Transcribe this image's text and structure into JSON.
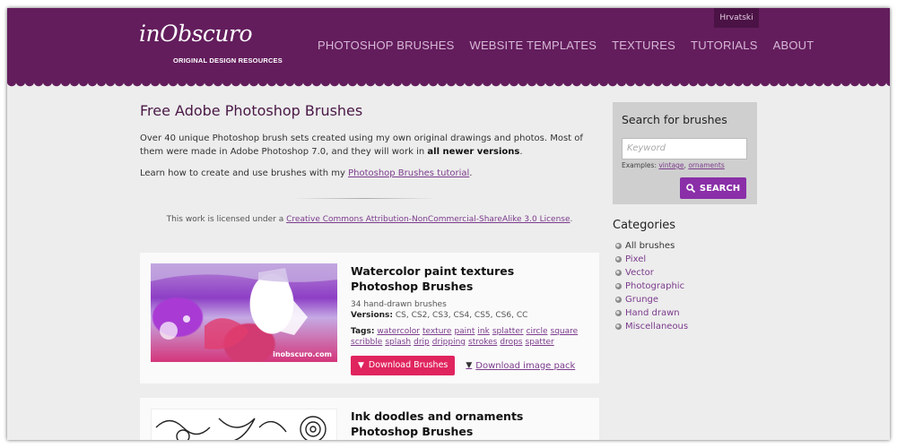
{
  "header": {
    "language_link": "Hrvatski",
    "logo_text": "inObscuro",
    "logo_subtitle": "ORIGINAL DESIGN RESOURCES",
    "nav": [
      "PHOTOSHOP BRUSHES",
      "WEBSITE TEMPLATES",
      "TEXTURES",
      "TUTORIALS",
      "ABOUT"
    ]
  },
  "main": {
    "title": "Free Adobe Photoshop Brushes",
    "intro_1": "Over 40 unique Photoshop brush sets created using my own original drawings and photos. Most of them were made in Adobe Photoshop 7.0, and they will work in ",
    "intro_1_bold": "all newer versions",
    "intro_1_end": ".",
    "intro_2": "Learn how to create and use brushes with my ",
    "intro_2_link": "Photoshop Brushes tutorial",
    "intro_2_end": ".",
    "license_text": "This work is licensed under a ",
    "license_link": "Creative Commons Attribution-NonCommercial-ShareAlike 3.0 License",
    "license_end": "."
  },
  "cards": [
    {
      "title": "Watercolor paint textures Photoshop Brushes",
      "count": "34 hand-drawn brushes",
      "versions_label": "Versions:",
      "versions": " CS, CS2, CS3, CS4, CS5, CS6, CC",
      "tags_label": "Tags:",
      "tags": [
        "watercolor",
        "texture",
        "paint",
        "ink",
        "splatter",
        "circle",
        "square",
        "scribble",
        "splash",
        "drip",
        "dripping",
        "strokes",
        "drops",
        "spatter"
      ],
      "watermark": "inobscuro.com",
      "download_label": "Download Brushes",
      "pack_label": "Download image pack"
    },
    {
      "title": "Ink doodles and ornaments Photoshop Brushes"
    }
  ],
  "sidebar": {
    "search_title": "Search for brushes",
    "keyword_placeholder": "Keyword",
    "examples_label": "Examples: ",
    "example_1": "vintage",
    "examples_sep": ", ",
    "example_2": "ornaments",
    "search_button": "SEARCH",
    "categories_title": "Categories",
    "categories": [
      "All brushes",
      "Pixel",
      "Vector",
      "Photographic",
      "Grunge",
      "Hand drawn",
      "Miscellaneous"
    ]
  },
  "colors": {
    "header": "#631d5c",
    "accent_link": "#7b3b8c",
    "download_button": "#e0245e",
    "search_button": "#8a2fa8"
  }
}
